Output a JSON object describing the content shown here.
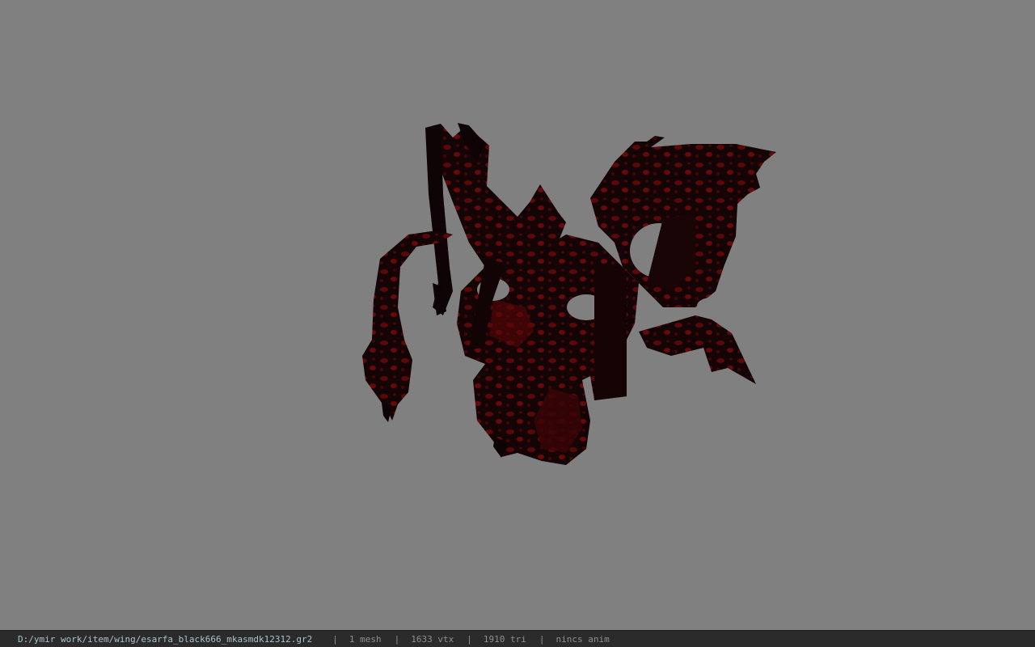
{
  "viewer": {
    "background_color": "#808080",
    "model_primary_color": "#0d0405",
    "model_highlight_color": "#7a0a0a"
  },
  "statusbar": {
    "file_path": "D:/ymir work/item/wing/esarfa_black666_mkasmdk12312.gr2",
    "separator": "|",
    "mesh_count": "1 mesh",
    "vertex_count": "1633 vtx",
    "triangle_count": "1910 tri",
    "anim_status": "nincs anim"
  }
}
